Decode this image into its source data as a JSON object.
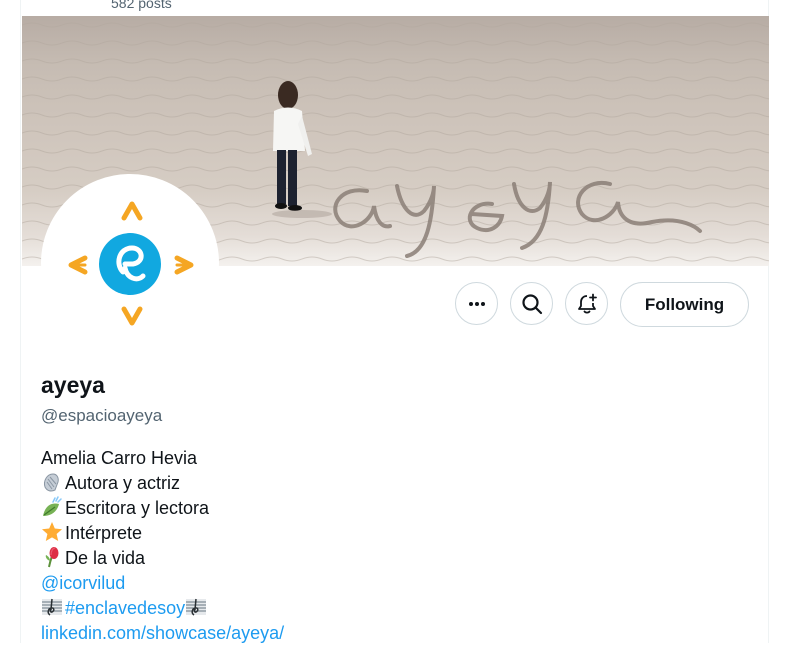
{
  "header": {
    "post_count": "582 posts"
  },
  "banner": {
    "written_text": "ayeya"
  },
  "actions": {
    "more_icon": "more-horizontal-icon",
    "search_icon": "search-icon",
    "notify_icon": "bell-plus-icon",
    "follow_label": "Following"
  },
  "profile": {
    "display_name": "ayeya",
    "handle": "@espacioayeya"
  },
  "bio": {
    "lines": [
      {
        "text": "Amelia Carro Hevia",
        "emoji": ""
      },
      {
        "text": "Autora y actriz",
        "emoji": "shell-icon"
      },
      {
        "text": "Escritora y lectora",
        "emoji": "leaf-icon"
      },
      {
        "text": "Intérprete",
        "emoji": "star-icon"
      },
      {
        "text": "De la vida",
        "emoji": "rosebud-icon"
      }
    ],
    "mention": "@icorvilud",
    "hashtag": "#enclavedesoy",
    "hashtag_emoji": "musical-score-icon",
    "url": "linkedin.com/showcase/ayeya/"
  },
  "colors": {
    "accent": "#1d9bf0",
    "text": "#0f1419",
    "muted": "#536471",
    "border": "#cfd9de",
    "logo_orange": "#f5a623",
    "logo_blue": "#11a8e0"
  }
}
